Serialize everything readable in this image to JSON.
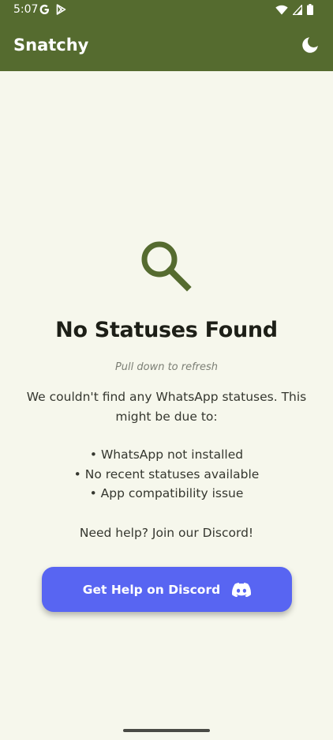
{
  "status_bar": {
    "time": "5:07",
    "left_icons": [
      "google-g-icon",
      "play-store-icon"
    ],
    "right_icons": [
      "wifi-icon",
      "cellular-signal-icon",
      "battery-icon"
    ]
  },
  "app_bar": {
    "title": "Snatchy",
    "action_icon": "moon-icon",
    "color": "#556b2f"
  },
  "empty_state": {
    "icon": "search-icon",
    "title": "No Statuses Found",
    "hint": "Pull down to refresh",
    "description": "We couldn't find any WhatsApp statuses. This might be due to:",
    "reasons": [
      "• WhatsApp not installed",
      "• No recent statuses available",
      "• App compatibility issue"
    ],
    "help_text": "Need help? Join our Discord!",
    "button": {
      "label": "Get Help on Discord",
      "icon": "discord-icon",
      "color": "#5865f2"
    }
  },
  "colors": {
    "background": "#f6f7ec",
    "accent": "#556b2f",
    "discord": "#5865f2"
  }
}
